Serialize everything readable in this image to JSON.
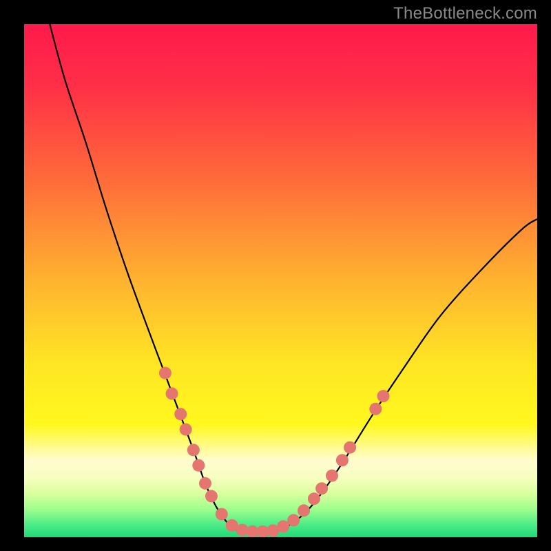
{
  "watermark": "TheBottleneck.com",
  "chart_data": {
    "type": "line",
    "title": "",
    "xlabel": "",
    "ylabel": "",
    "xlim": [
      0,
      100
    ],
    "ylim": [
      0,
      100
    ],
    "gradient_stops": [
      {
        "offset": 0.0,
        "color": "#ff1a4b"
      },
      {
        "offset": 0.12,
        "color": "#ff2f47"
      },
      {
        "offset": 0.3,
        "color": "#ff6a3a"
      },
      {
        "offset": 0.5,
        "color": "#ffb330"
      },
      {
        "offset": 0.66,
        "color": "#ffe524"
      },
      {
        "offset": 0.78,
        "color": "#fff81e"
      },
      {
        "offset": 0.85,
        "color": "#fffccf"
      },
      {
        "offset": 0.885,
        "color": "#f7ffc0"
      },
      {
        "offset": 0.915,
        "color": "#d8ff9e"
      },
      {
        "offset": 0.945,
        "color": "#9fff8c"
      },
      {
        "offset": 0.975,
        "color": "#4eec86"
      },
      {
        "offset": 1.0,
        "color": "#1fd977"
      }
    ],
    "series": [
      {
        "name": "bottleneck-curve",
        "x": [
          5,
          8,
          12,
          16,
          20,
          24,
          27,
          30,
          33,
          35.5,
          38,
          40.5,
          43,
          47,
          51,
          55,
          59,
          63,
          68,
          74,
          81,
          89,
          97,
          100
        ],
        "y": [
          100,
          89,
          77,
          64,
          52,
          41,
          33,
          25,
          17,
          10,
          5,
          2,
          1,
          1,
          2,
          5,
          10,
          16,
          24,
          33,
          43,
          52,
          60,
          62
        ]
      }
    ],
    "markers": {
      "name": "highlight-dots",
      "color": "#e4756f",
      "radius": 9,
      "points": [
        {
          "x": 27.5,
          "y": 32
        },
        {
          "x": 28.8,
          "y": 28
        },
        {
          "x": 30.5,
          "y": 24
        },
        {
          "x": 31.5,
          "y": 21
        },
        {
          "x": 33.0,
          "y": 17
        },
        {
          "x": 34.0,
          "y": 14
        },
        {
          "x": 35.3,
          "y": 10.5
        },
        {
          "x": 36.5,
          "y": 8
        },
        {
          "x": 38.5,
          "y": 4.5
        },
        {
          "x": 40.5,
          "y": 2.3
        },
        {
          "x": 42.5,
          "y": 1.4
        },
        {
          "x": 44.5,
          "y": 1.1
        },
        {
          "x": 46.5,
          "y": 1.1
        },
        {
          "x": 48.5,
          "y": 1.3
        },
        {
          "x": 50.5,
          "y": 2.1
        },
        {
          "x": 52.5,
          "y": 3.3
        },
        {
          "x": 54.5,
          "y": 5.2
        },
        {
          "x": 56.5,
          "y": 7.5
        },
        {
          "x": 58.0,
          "y": 9.5
        },
        {
          "x": 60.0,
          "y": 12
        },
        {
          "x": 62.0,
          "y": 15
        },
        {
          "x": 63.5,
          "y": 17.5
        },
        {
          "x": 68.5,
          "y": 25
        },
        {
          "x": 70.0,
          "y": 27.5
        }
      ]
    }
  }
}
